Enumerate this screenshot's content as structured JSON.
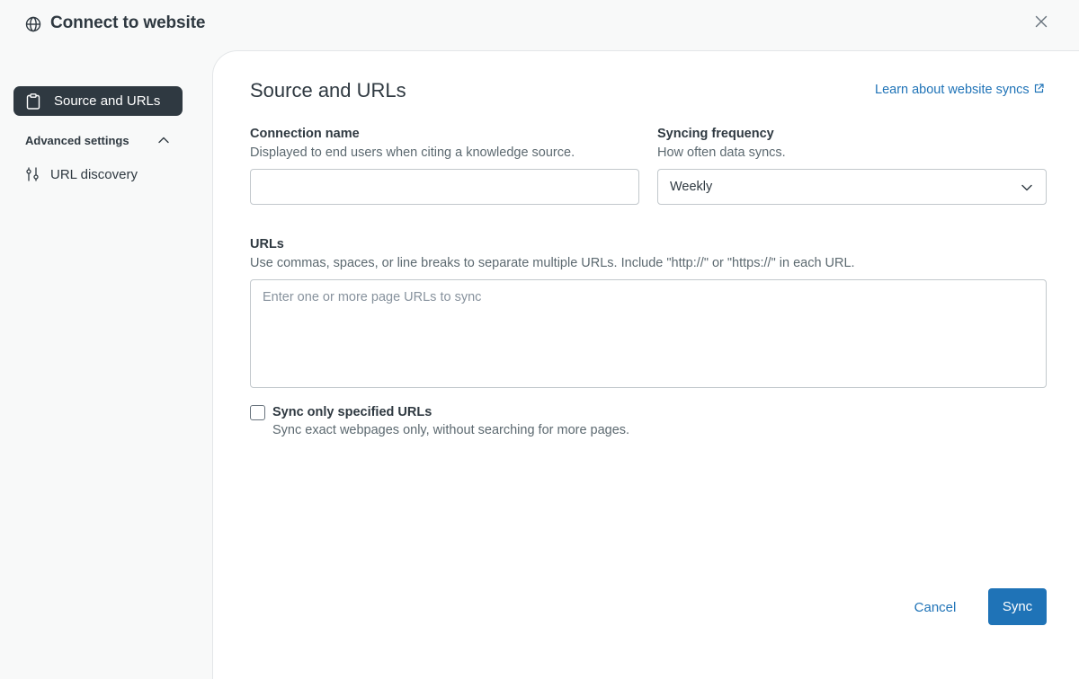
{
  "header": {
    "title": "Connect to website",
    "icon": "globe-icon",
    "close_icon": "close-icon"
  },
  "sidebar": {
    "active_item": {
      "label": "Source and URLs",
      "icon": "clipboard-icon"
    },
    "section": {
      "label": "Advanced settings",
      "expanded": true,
      "icon": "chevron-up-icon"
    },
    "items": [
      {
        "label": "URL discovery",
        "icon": "sliders-icon"
      }
    ]
  },
  "main": {
    "title": "Source and URLs",
    "learn_link": "Learn about website syncs",
    "connection_name": {
      "label": "Connection name",
      "hint": "Displayed to end users when citing a knowledge source.",
      "value": "",
      "placeholder": ""
    },
    "syncing_frequency": {
      "label": "Syncing frequency",
      "hint": "How often data syncs.",
      "value": "Weekly"
    },
    "urls": {
      "label": "URLs",
      "hint": "Use commas, spaces, or line breaks to separate multiple URLs. Include \"http://\" or \"https://\" in each URL.",
      "placeholder": "Enter one or more page URLs to sync"
    },
    "sync_only": {
      "label": "Sync only specified URLs",
      "hint": "Sync exact webpages only, without searching for more pages.",
      "checked": false
    }
  },
  "footer": {
    "cancel_label": "Cancel",
    "sync_label": "Sync"
  },
  "colors": {
    "accent": "#1f73b7",
    "dark": "#2f3941",
    "border": "#c2c8cc",
    "background": "#f8f9f9"
  }
}
